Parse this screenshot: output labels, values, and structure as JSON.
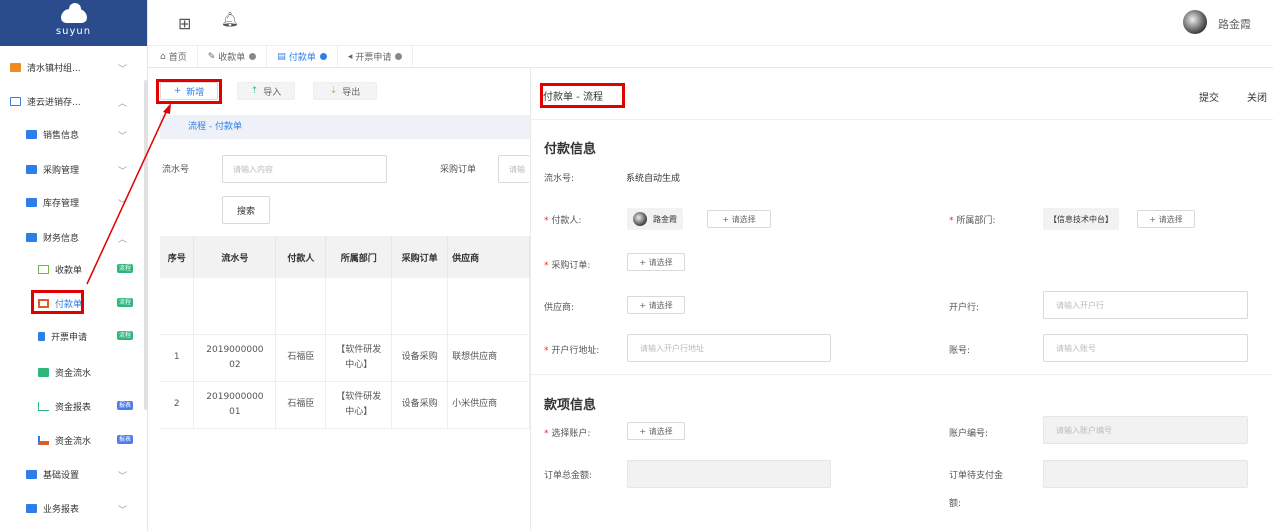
{
  "brand": {
    "logo_text": "suyun"
  },
  "user": {
    "name": "路金霞"
  },
  "sidebar": {
    "items": [
      {
        "label": "清水镇村组...",
        "chev": "﹀"
      },
      {
        "label": "速云进销存...",
        "chev": "︿"
      },
      {
        "label": "销售信息",
        "chev": "﹀"
      },
      {
        "label": "采购管理",
        "chev": "﹀"
      },
      {
        "label": "库存管理",
        "chev": "﹀"
      },
      {
        "label": "财务信息",
        "chev": "︿"
      },
      {
        "label": "收款单",
        "badge": "流程"
      },
      {
        "label": "付款单",
        "badge": "流程"
      },
      {
        "label": "开票申请",
        "badge": "流程"
      },
      {
        "label": "资金流水"
      },
      {
        "label": "资金报表",
        "badge": "报表"
      },
      {
        "label": "资金流水",
        "badge": "报表"
      },
      {
        "label": "基础设置",
        "chev": "﹀"
      },
      {
        "label": "业务报表",
        "chev": "﹀"
      }
    ]
  },
  "tabs": [
    {
      "label": "首页"
    },
    {
      "label": "收款单"
    },
    {
      "label": "付款单"
    },
    {
      "label": "开票申请"
    }
  ],
  "toolbar": {
    "add": "新增",
    "import": "导入",
    "export": "导出"
  },
  "list": {
    "flow_title": "流程 - 付款单",
    "filter_serial_label": "流水号",
    "filter_serial_placeholder": "请输入内容",
    "filter_po_label": "采购订单",
    "filter_po_placeholder": "请输",
    "search": "搜索",
    "columns": [
      "序号",
      "流水号",
      "付款人",
      "所属部门",
      "采购订单",
      "供应商"
    ],
    "rows": [
      {
        "idx": "1",
        "serial_a": "2019000000",
        "serial_b": "02",
        "payer": "石福臣",
        "dept_a": "【软件研发",
        "dept_b": "中心】",
        "po": "设备采购",
        "supplier": "联想供应商"
      },
      {
        "idx": "2",
        "serial_a": "2019000000",
        "serial_b": "01",
        "payer": "石福臣",
        "dept_a": "【软件研发",
        "dept_b": "中心】",
        "po": "设备采购",
        "supplier": "小米供应商"
      }
    ]
  },
  "panel": {
    "title": "付款单 - 流程",
    "submit": "提交",
    "close": "关闭",
    "section_payment": "付款信息",
    "serial_label": "流水号:",
    "serial_value": "系统自动生成",
    "payer_label": "付款人:",
    "payer_name": "路金霞",
    "select": "+ 请选择",
    "dept_label": "所属部门:",
    "dept_value": "【信息技术中台】",
    "po_label": "采购订单:",
    "supplier_label": "供应商:",
    "bank_label": "开户行:",
    "bank_placeholder": "请输入开户行",
    "bank_addr_label": "开户行地址:",
    "bank_addr_placeholder": "请输入开户行地址",
    "account_label": "账号:",
    "account_placeholder": "请输入账号",
    "section_amount": "款项信息",
    "choose_account_label": "选择账户:",
    "account_no_label": "账户编号:",
    "account_no_placeholder": "请输入账户编号",
    "order_total_label": "订单总金额:",
    "order_pending_label_a": "订单待支付金",
    "order_pending_label_b": "额:"
  },
  "colors": {
    "accent": "#2d7ee8",
    "brand": "#2b4c8c",
    "highlight": "#e00000",
    "badge_green": "#2fb67b",
    "badge_blue": "#4a7de8"
  }
}
